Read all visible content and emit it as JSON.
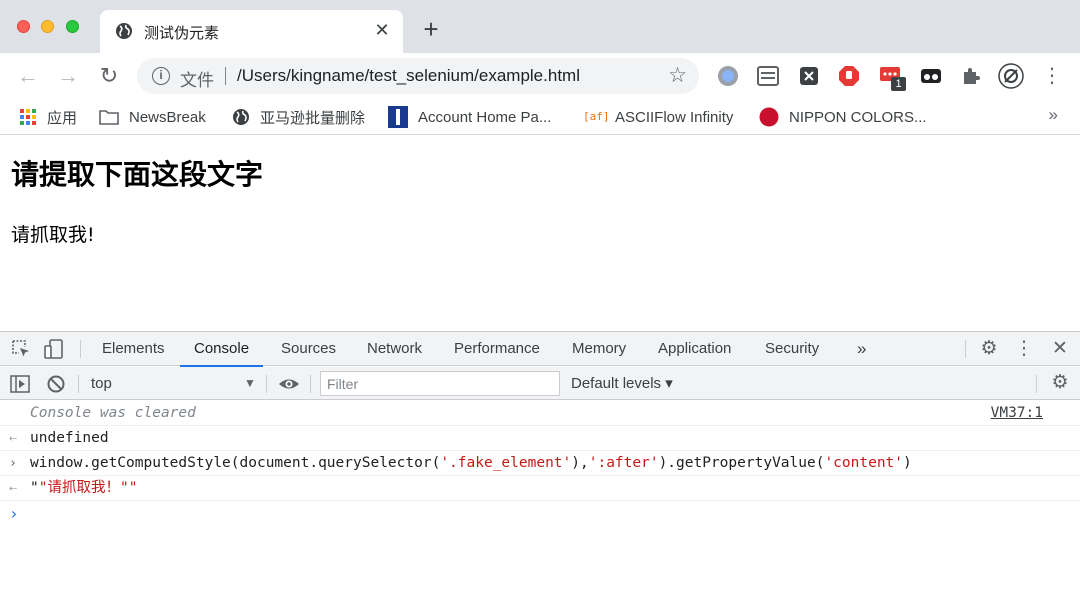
{
  "tab": {
    "title": "测试伪元素",
    "close": "✕",
    "new_tab": "+"
  },
  "toolbar": {
    "back": "←",
    "forward": "→",
    "reload": "↻",
    "security_label": "文件",
    "url": "/Users/kingname/test_selenium/example.html",
    "star": "☆",
    "badge_count": "1"
  },
  "bookmarks": {
    "items": [
      {
        "label": "应用",
        "icon": "apps-grid-icon"
      },
      {
        "label": "NewsBreak",
        "icon": "folder-icon"
      },
      {
        "label": "亚马逊批量删除",
        "icon": "globe-icon"
      },
      {
        "label": "Account Home Pa...",
        "icon": "bookmark-site-icon"
      },
      {
        "label": "ASCIIFlow Infinity",
        "icon": "asciiflow-icon"
      },
      {
        "label": "NIPPON COLORS...",
        "icon": "red-dot-icon"
      }
    ],
    "more": "»",
    "asciiflow_glyph": "[af]"
  },
  "page": {
    "heading": "请提取下面这段文字",
    "text": "请抓取我!"
  },
  "devtools": {
    "tabs": [
      "Elements",
      "Console",
      "Sources",
      "Network",
      "Performance",
      "Memory",
      "Application",
      "Security"
    ],
    "active_tab": "Console",
    "more_tabs": "»",
    "context": "top",
    "filter_placeholder": "Filter",
    "levels": "Default levels ▾",
    "console": {
      "cleared": "Console was cleared",
      "vm_link": "VM37:1",
      "undefined": "undefined",
      "cmd": {
        "p1": "window.getComputedStyle(document.querySelector(",
        "s1": "'.fake_element'",
        "p2": "),",
        "s2": "':after'",
        "p3": ").getPropertyValue(",
        "s3": "'content'",
        "p4": ")"
      },
      "result_quote": "\"",
      "result": "\"请抓取我！\"\""
    }
  },
  "colors": {
    "accent": "#1a73e8",
    "string": "#c41a16",
    "tabstrip": "#dee1e6"
  }
}
